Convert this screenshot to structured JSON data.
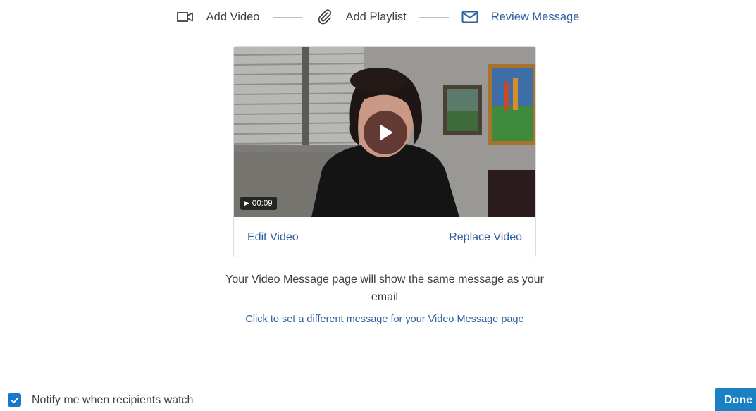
{
  "stepper": {
    "steps": [
      {
        "label": "Add Video",
        "icon": "video-camera-icon",
        "active": false
      },
      {
        "label": "Add Playlist",
        "icon": "paperclip-icon",
        "active": false
      },
      {
        "label": "Review Message",
        "icon": "envelope-icon",
        "active": true
      }
    ]
  },
  "video": {
    "duration": "00:09",
    "edit_label": "Edit Video",
    "replace_label": "Replace Video"
  },
  "message": {
    "info": "Your Video Message page will show the same message as your email",
    "link": "Click to set a different message for your Video Message page"
  },
  "footer": {
    "notify_label": "Notify me when recipients watch",
    "notify_checked": true,
    "done_label": "Done"
  },
  "colors": {
    "accent": "#2f5f9e",
    "button": "#1a82c4",
    "checkbox": "#1679c9"
  }
}
